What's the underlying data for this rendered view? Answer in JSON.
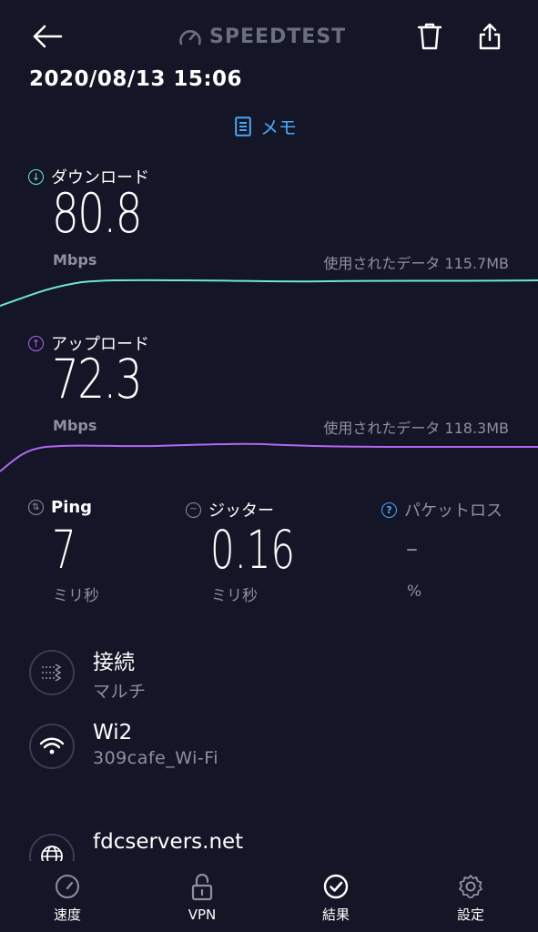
{
  "header": {
    "back_icon": "arrow-left-icon",
    "logo_text": "SPEEDTEST",
    "delete_icon": "trash-icon",
    "share_icon": "share-icon",
    "datetime": "2020/08/13 15:06",
    "memo_label": "メモ"
  },
  "download": {
    "label": "ダウンロード",
    "value": "80.8",
    "unit": "Mbps",
    "usage": "使用されたデータ 115.7MB",
    "color": "#6ee7d4"
  },
  "upload": {
    "label": "アップロード",
    "value": "72.3",
    "unit": "Mbps",
    "usage": "使用されたデータ 118.3MB",
    "color": "#b069f0"
  },
  "stats": {
    "ping": {
      "label": "Ping",
      "value": "7",
      "unit": "ミリ秒"
    },
    "jitter": {
      "label": "ジッター",
      "value": "0.16",
      "unit": "ミリ秒"
    },
    "packet_loss": {
      "label": "パケットロス",
      "value": "–",
      "unit": "%"
    }
  },
  "info": [
    {
      "icon": "connections-icon",
      "title": "接続",
      "subtitle": "マルチ"
    },
    {
      "icon": "wifi-icon",
      "title": "Wi2",
      "subtitle": "309cafe_Wi-Fi"
    },
    {
      "icon": "globe-icon",
      "title": "fdcservers.net",
      "subtitle": ""
    }
  ],
  "nav": [
    {
      "icon": "speed-gauge-icon",
      "label": "速度"
    },
    {
      "icon": "lock-icon",
      "label": "VPN"
    },
    {
      "icon": "check-circle-icon",
      "label": "結果"
    },
    {
      "icon": "gear-icon",
      "label": "設定"
    }
  ]
}
